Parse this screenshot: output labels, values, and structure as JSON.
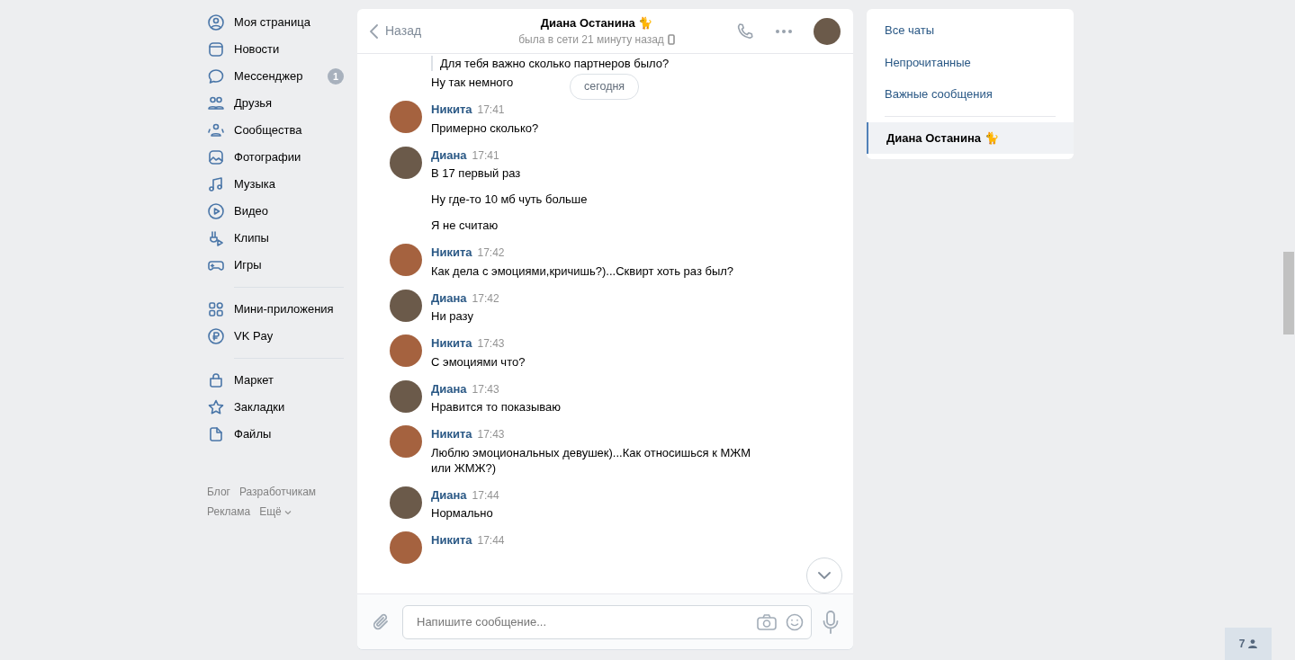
{
  "nav_groups": [
    [
      {
        "label": "Моя страница"
      },
      {
        "label": "Новости"
      },
      {
        "label": "Мессенджер",
        "badge": "1"
      },
      {
        "label": "Друзья"
      },
      {
        "label": "Сообщества"
      },
      {
        "label": "Фотографии"
      },
      {
        "label": "Музыка"
      },
      {
        "label": "Видео"
      },
      {
        "label": "Клипы"
      },
      {
        "label": "Игры"
      }
    ],
    [
      {
        "label": "Мини-приложения"
      },
      {
        "label": "VK Pay"
      }
    ],
    [
      {
        "label": "Маркет"
      },
      {
        "label": "Закладки"
      },
      {
        "label": "Файлы"
      }
    ]
  ],
  "footer_links": [
    "Блог",
    "Разработчикам",
    "Реклама",
    "Ещё"
  ],
  "chat": {
    "back": "Назад",
    "title": "Диана Останина 🐈",
    "status": "была в сети 21 минуту назад",
    "date_pill": "сегодня",
    "quote": "Для тебя важно сколько партнеров было?",
    "first_text": "Ну так немного",
    "messages": [
      {
        "author": "Никита",
        "time": "17:41",
        "texts": [
          "Примерно сколько?"
        ]
      },
      {
        "author": "Диана",
        "time": "17:41",
        "texts": [
          "В 17 первый раз",
          "Ну где-то 10 мб чуть больше",
          "Я не считаю"
        ]
      },
      {
        "author": "Никита",
        "time": "17:42",
        "texts": [
          "Как дела с эмоциями,кричишь?)...Сквирт хоть раз был?"
        ]
      },
      {
        "author": "Диана",
        "time": "17:42",
        "texts": [
          "Ни разу"
        ]
      },
      {
        "author": "Никита",
        "time": "17:43",
        "texts": [
          "С эмоциями что?"
        ]
      },
      {
        "author": "Диана",
        "time": "17:43",
        "texts": [
          "Нравится то показываю"
        ]
      },
      {
        "author": "Никита",
        "time": "17:43",
        "texts": [
          "Люблю эмоциональных девушек)...Как относишься к МЖМ или ЖМЖ?)"
        ]
      },
      {
        "author": "Диана",
        "time": "17:44",
        "texts": [
          "Нормально"
        ]
      },
      {
        "author": "Никита",
        "time": "17:44"
      }
    ],
    "composer": {
      "placeholder": "Напишите сообщение..."
    }
  },
  "filters": [
    {
      "label": "Все чаты",
      "selected": false
    },
    {
      "label": "Непрочитанные",
      "selected": false
    },
    {
      "label": "Важные сообщения",
      "selected": false
    }
  ],
  "conversations": [
    {
      "label": "Диана Останина 🐈",
      "selected": true
    }
  ],
  "online_count": "7"
}
